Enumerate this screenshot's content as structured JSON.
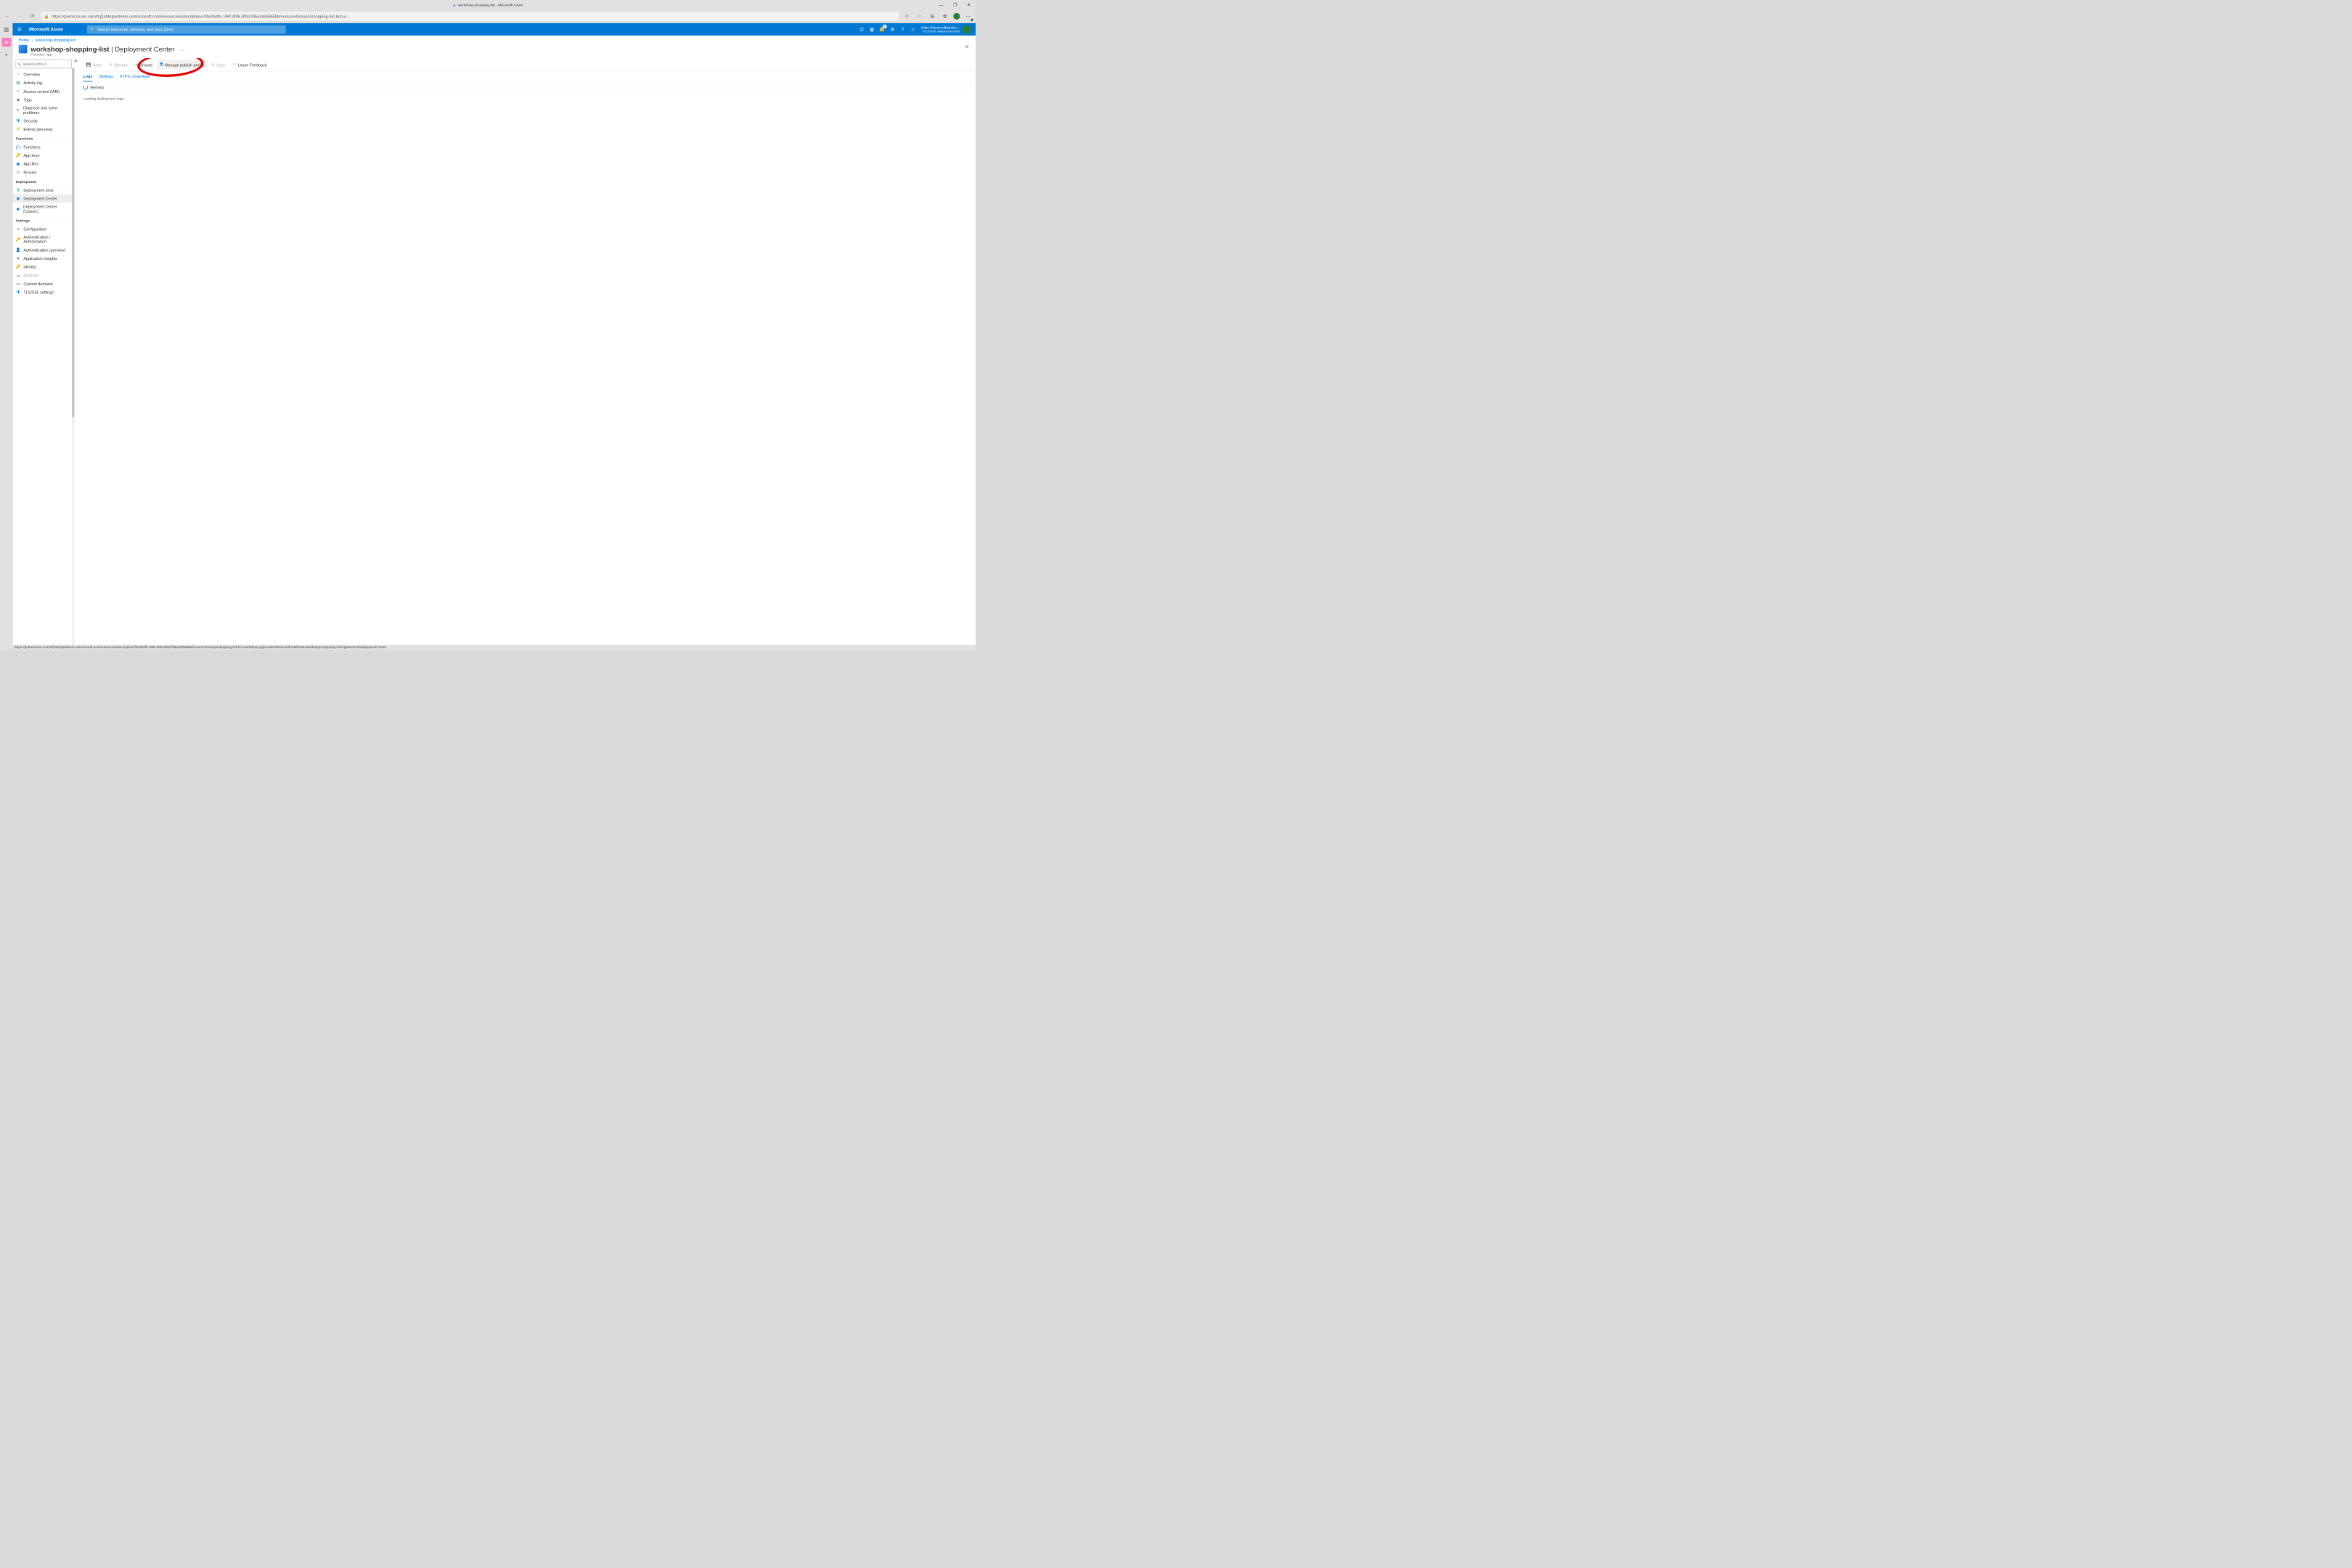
{
  "window": {
    "title": "workshop-shopping-list - Microsoft Azure"
  },
  "browser": {
    "url": "https://portal.azure.com/#@stdntpartners.onmicrosoft.com/resource/subscriptions/f4e2bdfb-196f-4f46-8f0d-f95a3dd5868d/resourceGroups/shopping-list-bot-w…"
  },
  "status_url": "https://portal.azure.com/#@stdntpartners.onmicrosoft.com/resource/subscriptions/f4e2bdfb-196f-4f46-8f0d-f95a3dd5868d/resourceGroups/shopping-list-bot-workshop-rg/providers/Microsoft.Web/sites/workshop-shopping-list/AppServiceDeploymentCenter",
  "header": {
    "brand": "Microsoft Azure",
    "search_placeholder": "Search resources, services, and docs (G+/)",
    "notif_count": "1",
    "account_line1": "Malte.Reimann@studen…",
    "account_line2": "STUDENT AMBASSADORS"
  },
  "breadcrumb": {
    "home": "Home",
    "current": "workshop-shopping-list"
  },
  "page": {
    "title_main": "workshop-shopping-list",
    "title_suffix": " | Deployment Center",
    "subtitle": "Function App",
    "dots": "…"
  },
  "sidebar": {
    "search_placeholder": "Search (Ctrl+/)",
    "groups": {
      "functions": "Functions",
      "deployment": "Deployment",
      "settings": "Settings"
    },
    "items": {
      "overview": "Overview",
      "activity": "Activity log",
      "iam": "Access control (IAM)",
      "tags": "Tags",
      "diagnose": "Diagnose and solve problems",
      "security": "Security",
      "events": "Events (preview)",
      "functions": "Functions",
      "appkeys": "App keys",
      "appfiles": "App files",
      "proxies": "Proxies",
      "slots": "Deployment slots",
      "center": "Deployment Center",
      "centerclassic": "Deployment Center (Classic)",
      "config": "Configuration",
      "authz": "Authentication / Authorization",
      "authp": "Authentication (preview)",
      "insights": "Application Insights",
      "identity": "Identity",
      "backups": "Backups",
      "domains": "Custom domains",
      "tls": "TLS/SSL settings"
    }
  },
  "toolbar": {
    "save": "Save",
    "discard": "Discard",
    "browse": "Browse",
    "manage": "Manage publish profile",
    "sync": "Sync",
    "feedback": "Leave Feedback"
  },
  "tabs": {
    "logs": "Logs",
    "settings": "Settings",
    "ftps": "FTPS credentials"
  },
  "refresh": "Refresh",
  "loading": "Loading deployment logs..."
}
